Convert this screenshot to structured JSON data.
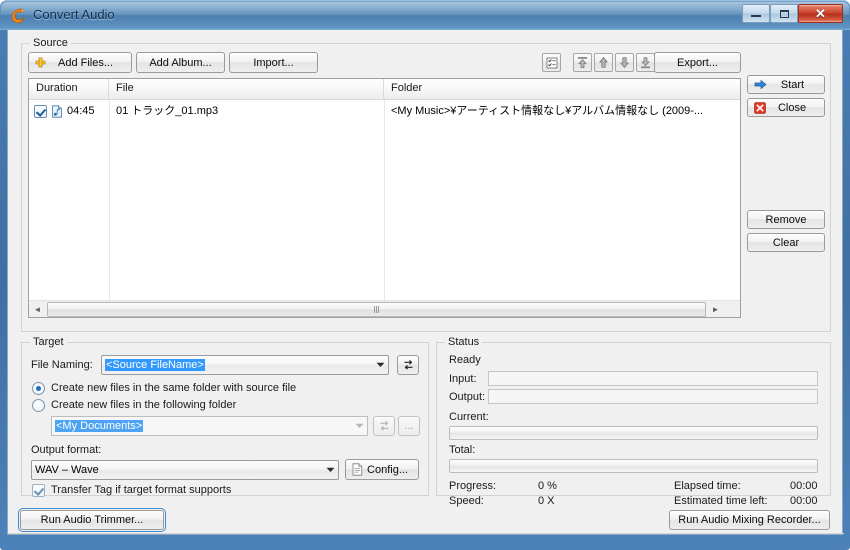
{
  "window": {
    "title": "Convert Audio",
    "icon": "app-swoosh-icon",
    "controls": {
      "minimize": "–",
      "maximize": "□",
      "close": "✕"
    }
  },
  "source": {
    "group_label": "Source",
    "buttons": {
      "add_files": "Add Files...",
      "add_album": "Add Album...",
      "import": "Import...",
      "export": "Export..."
    },
    "toolbar_icons": [
      "check-all-icon",
      "move-to-top-icon",
      "move-up-icon",
      "move-down-icon",
      "move-to-bottom-icon"
    ],
    "columns": [
      "Duration",
      "File",
      "Folder"
    ],
    "rows": [
      {
        "checked": true,
        "file_icon": "audio-file-icon",
        "duration": "04:45",
        "file": "01 トラック_01.mp3",
        "folder": "<My Music>¥アーティスト情報なし¥アルバム情報なし (2009-..."
      }
    ],
    "scroll_left_arrow": "◄",
    "scroll_right_arrow": "►"
  },
  "actions": {
    "start": "Start",
    "start_icon": "blue-arrow-icon",
    "close": "Close",
    "close_icon": "red-close-icon",
    "remove": "Remove",
    "clear": "Clear"
  },
  "target": {
    "group_label": "Target",
    "file_naming_label": "File Naming:",
    "file_naming_value": "<Source FileName>",
    "file_naming_swap_icon": "swap-arrows-icon",
    "radio_same_folder": "Create new files in the same folder with source file",
    "radio_following_folder": "Create new files in the following folder",
    "radio_selected": "same_folder",
    "folder_value": "<My Documents>",
    "folder_swap_icon": "swap-arrows-icon",
    "folder_browse_label": "...",
    "output_format_label": "Output format:",
    "output_format_value": "WAV – Wave",
    "config_label": "Config...",
    "config_icon": "document-icon",
    "transfer_tag_label": "Transfer Tag if target format supports",
    "transfer_tag_checked": true
  },
  "status": {
    "group_label": "Status",
    "ready": "Ready",
    "input_label": "Input:",
    "input_value": "",
    "output_label": "Output:",
    "output_value": "",
    "current_label": "Current:",
    "current_percent": 0,
    "total_label": "Total:",
    "total_percent": 0,
    "progress_label": "Progress:",
    "progress_value": "0 %",
    "speed_label": "Speed:",
    "speed_value": "0 X",
    "elapsed_label": "Elapsed time:",
    "elapsed_value": "00:00",
    "eta_label": "Estimated time left:",
    "eta_value": "00:00"
  },
  "footer": {
    "run_trimmer": "Run Audio Trimmer...",
    "run_mixer": "Run Audio Mixing Recorder..."
  },
  "colors": {
    "titlebar_blue": "#5a8cba",
    "frame_blue": "#4a7fb5",
    "accent_orange": "#f08a1c",
    "selection_blue": "#3399ff",
    "close_red": "#c8402a"
  }
}
